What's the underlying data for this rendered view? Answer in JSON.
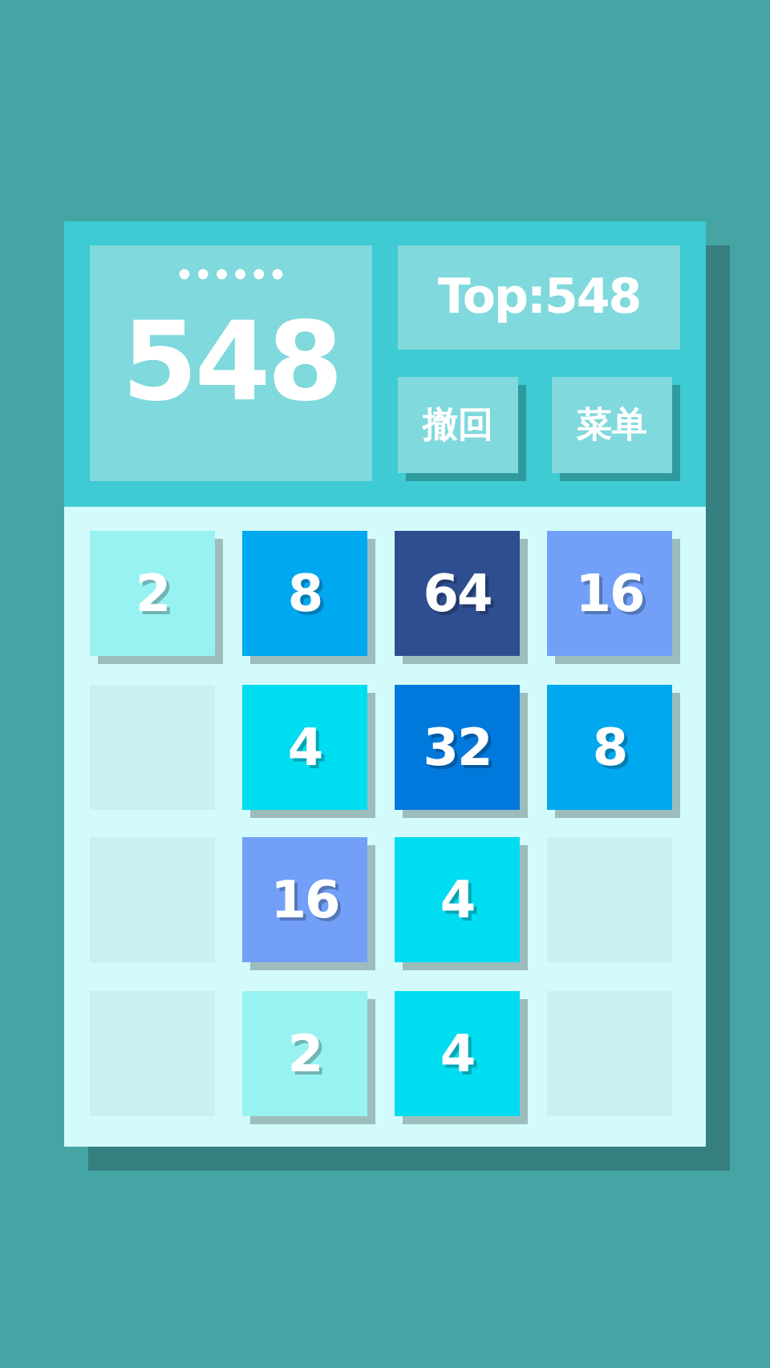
{
  "score": {
    "value": "548"
  },
  "best": {
    "label": "Top:548"
  },
  "buttons": [
    {
      "label": "撤回"
    },
    {
      "label": "菜单"
    }
  ],
  "board": [
    [
      {
        "kind": "tile",
        "value": "2",
        "color": "#98f2f2"
      },
      {
        "kind": "tile",
        "value": "8",
        "color": "#00a8f0"
      },
      {
        "kind": "tile",
        "value": "64",
        "color": "#2e4e90"
      },
      {
        "kind": "tile",
        "value": "16",
        "color": "#72a0f8"
      }
    ],
    [
      {
        "kind": "empty"
      },
      {
        "kind": "tile",
        "value": "4",
        "color": "#00dcf0"
      },
      {
        "kind": "tile",
        "value": "32",
        "color": "#0078dc"
      },
      {
        "kind": "tile",
        "value": "8",
        "color": "#00a8f0"
      }
    ],
    [
      {
        "kind": "empty"
      },
      {
        "kind": "tile",
        "value": "16",
        "color": "#72a0f8"
      },
      {
        "kind": "tile",
        "value": "4",
        "color": "#00dcf0"
      },
      {
        "kind": "empty"
      }
    ],
    [
      {
        "kind": "empty"
      },
      {
        "kind": "tile",
        "value": "2",
        "color": "#98f2f2"
      },
      {
        "kind": "tile",
        "value": "4",
        "color": "#00dcf0"
      },
      {
        "kind": "empty"
      }
    ]
  ]
}
